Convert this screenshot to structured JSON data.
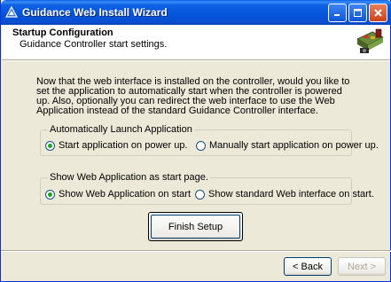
{
  "window": {
    "title": "Guidance Web Install Wizard"
  },
  "header": {
    "title": "Startup Configuration",
    "subtitle": "Guidance Controller start settings."
  },
  "intro": "Now that the web interface is installed on the controller, would you like to set the application to automatically start when the controller is powered up.  Also, optionally you can redirect the web interface to use the Web Application instead of the standard Guidance Controller interface.",
  "auto_launch": {
    "label": "Automatically Launch Application",
    "options": [
      {
        "label": "Start application on power up.",
        "selected": true
      },
      {
        "label": "Manually start application on power up.",
        "selected": false
      }
    ]
  },
  "start_page": {
    "label": "Show Web Application as start page.",
    "options": [
      {
        "label": "Show Web Application on start",
        "selected": true
      },
      {
        "label": "Show standard Web interface on start.",
        "selected": false
      }
    ]
  },
  "buttons": {
    "finish": "Finish Setup",
    "back": "< Back",
    "next": "Next >"
  }
}
